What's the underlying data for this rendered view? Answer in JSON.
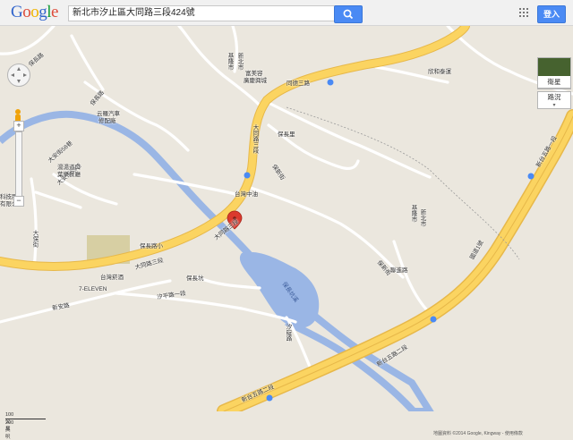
{
  "header": {
    "logo": [
      {
        "ch": "G",
        "color": "#3366cc"
      },
      {
        "ch": "o",
        "color": "#dd4b39"
      },
      {
        "ch": "o",
        "color": "#f0b400"
      },
      {
        "ch": "g",
        "color": "#3366cc"
      },
      {
        "ch": "l",
        "color": "#119c33"
      },
      {
        "ch": "e",
        "color": "#dd4b39"
      }
    ],
    "search_value": "新北市汐止區大同路三段424號",
    "search_icon": "search-icon",
    "apps_icon": "apps-grid-icon",
    "signin_label": "登入"
  },
  "controls": {
    "pan_icon": "pan-arrows-icon",
    "pegman_icon": "pegman-icon",
    "zoom_in_label": "+",
    "zoom_out_label": "−",
    "satellite_label": "衛星",
    "traffic_label": "路況",
    "traffic_dropdown_icon": "chevron-down-icon"
  },
  "marker": {
    "icon": "red-location-pin-icon",
    "color": "#db3a2d"
  },
  "colors": {
    "land": "#ebe7de",
    "highway": "#fbd461",
    "highway_edge": "#e7b849",
    "water": "#9ab6e5",
    "park": "#d7cfa3",
    "minor_road": "#ffffff",
    "route_shield": "#4a8af4"
  },
  "map_labels": {
    "datong_road_3_upper": "同德三路",
    "datong_road_3_vertical": "大同路三段",
    "datong_road_3_lower": "大同路三段",
    "datong_road_3_mid": "大同路三段",
    "keelung_east": "基隆市",
    "keelung_river_vertical": "基隆市",
    "xinbei_vertical": "新北市",
    "keelung_right": "基隆市",
    "xinbei_right": "新北市",
    "banqiao_temple": "富美容",
    "banqiao_temple2": "廣慶興城",
    "youqiu": "欣和泰運",
    "yungqiang": "云羅汽車",
    "yungqiang2": "修配廠",
    "baochang_road_upper": "保長路",
    "baochang_road_mid": "保長路",
    "baochang_area": "保長里",
    "baochang_school": "保長路小",
    "baoxin_street_upper": "保新街",
    "baoxin_street_lower": "保新街",
    "taiwan_zhongyou": "台灣中油",
    "taiwan_yingye": "台灣菸酒",
    "seven_eleven": "7-ELEVEN",
    "xinan_road": "新安路",
    "xingping_road": "汐平路一段",
    "baoqiao": "保長坑",
    "datong_road_1": "大同路一段",
    "taian_rd_56": "大安街56巷",
    "taian_rd_53": "大安街53巷",
    "kaiyuan": "開元",
    "kaiyuan2": "卡奈",
    "xinzhuang": "湯湯道口",
    "xinzhuang2": "葉樂餐廳",
    "kejiyuan": "科技股份",
    "kejiyuan2": "有限公司",
    "dachong": "大保街",
    "baochang_river": "保長坑溪",
    "jiedong": "聯進路",
    "xintai_5_lower": "新台五路二段",
    "xintai_5_upper": "新台五路二段",
    "xintai_5_right": "新台五路一段",
    "national_freeway": "國道1號",
    "datong_road_2": "大同路二段",
    "wanli_road": "北七股道",
    "taiwan_small": "保長路",
    "cross_road": "汐碇路"
  },
  "scale": {
    "metric": "100 公尺",
    "imperial": "200 英呎"
  },
  "attribution": "地圖資料 ©2014 Google, Kingway - 使用條款"
}
